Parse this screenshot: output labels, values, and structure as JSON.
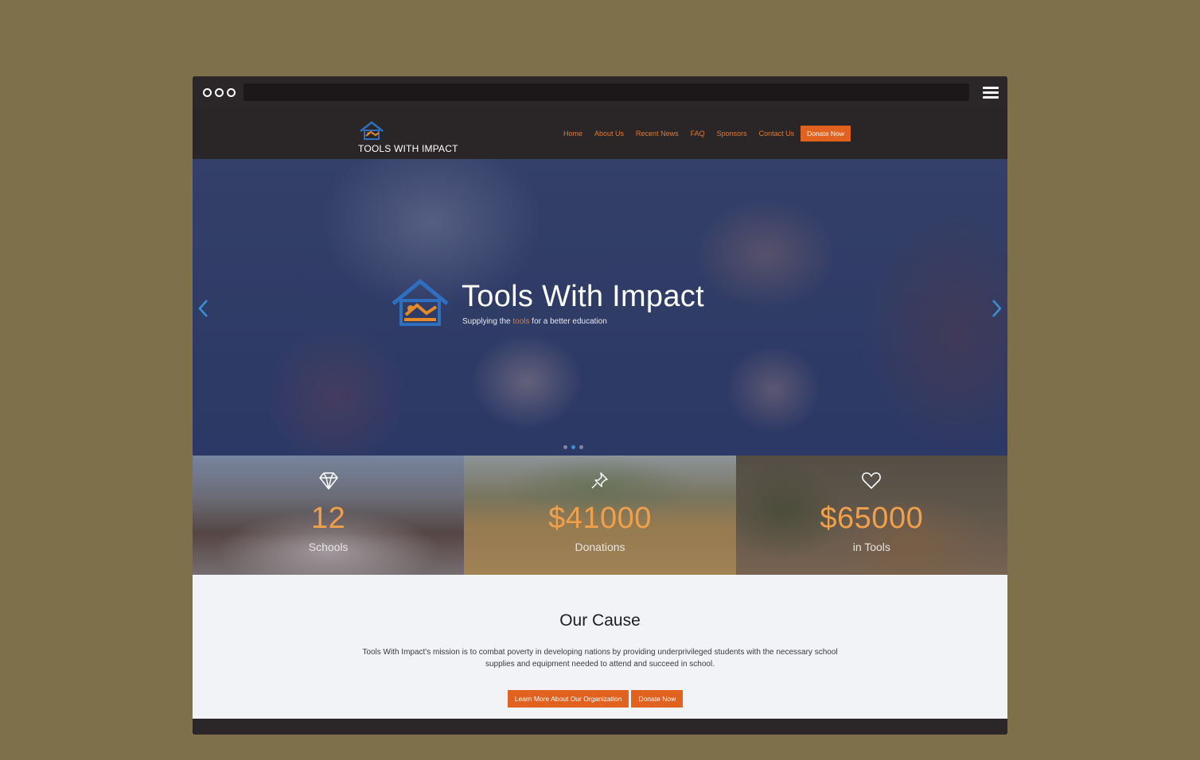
{
  "site": {
    "brand_name": "TOOLS WITH IMPACT",
    "nav": [
      {
        "label": "Home"
      },
      {
        "label": "About Us"
      },
      {
        "label": "Recent News"
      },
      {
        "label": "FAQ"
      },
      {
        "label": "Sponsors"
      },
      {
        "label": "Contact Us"
      }
    ],
    "nav_donate": "Donate Now"
  },
  "hero": {
    "title": "Tools With Impact",
    "subtitle_before": "Supplying the ",
    "subtitle_accent": "tools",
    "subtitle_after": " for a better education",
    "slide_count": 3,
    "active_slide": 2
  },
  "stats": [
    {
      "icon": "diamond-icon",
      "value": "12",
      "label": "Schools"
    },
    {
      "icon": "pushpin-icon",
      "value": "$41000",
      "label": "Donations"
    },
    {
      "icon": "heart-icon",
      "value": "$65000",
      "label": "in Tools"
    }
  ],
  "cause": {
    "title": "Our Cause",
    "text": "Tools With Impact's mission is to combat poverty in developing nations by providing underprivileged students with the necessary school supplies and equipment needed to attend and succeed in school.",
    "learn_button": "Learn More About Our Organization",
    "donate_button": "Donate Now"
  },
  "colors": {
    "accent": "#e0621e",
    "nav_link": "#e27a2e",
    "stat_value": "#f0a04b",
    "navbar_bg": "#2a2628",
    "page_bg": "#7d704b"
  }
}
